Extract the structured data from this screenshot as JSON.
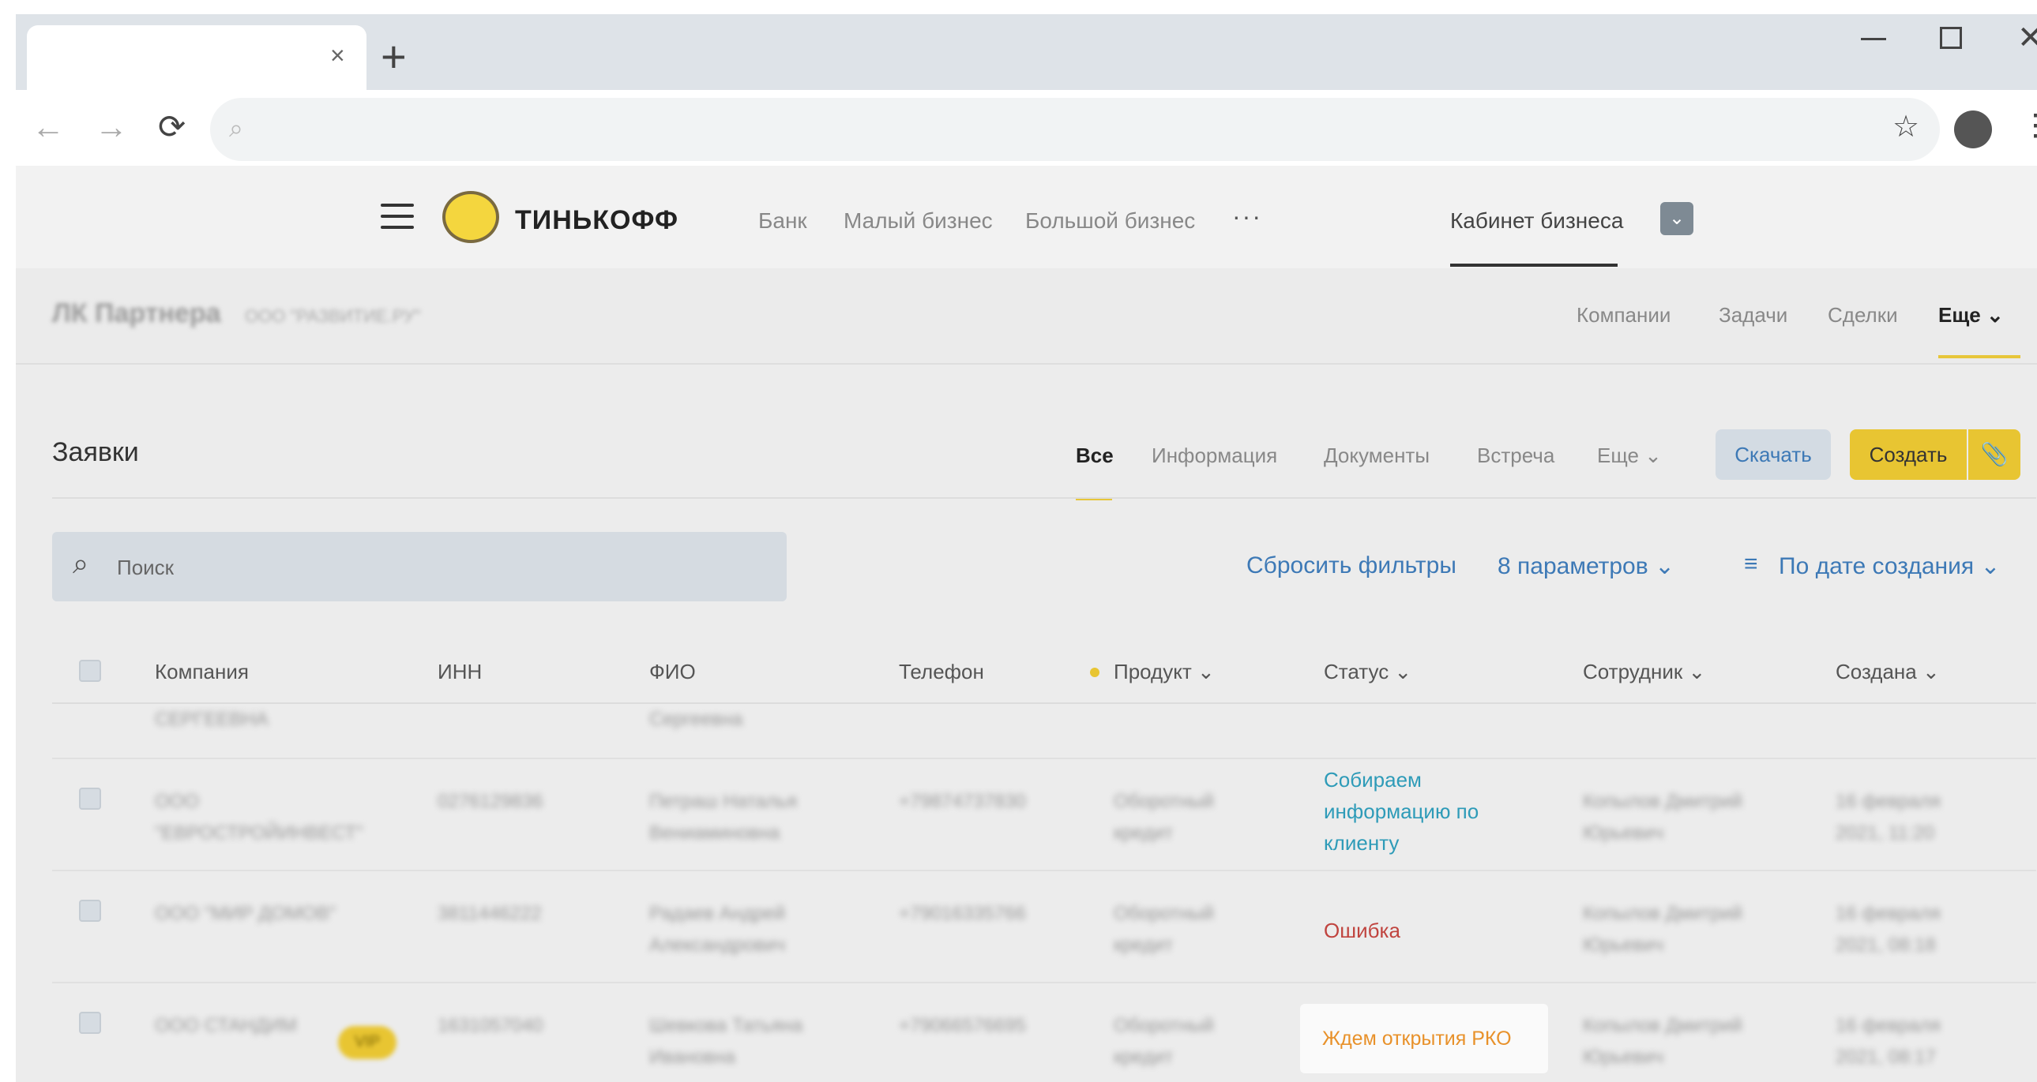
{
  "browser": {
    "tab_close": "×",
    "new_tab": "+",
    "window_close": "✕"
  },
  "header": {
    "logo_text": "ТИНЬКОФФ",
    "nav": [
      "Банк",
      "Малый бизнес",
      "Большой бизнес"
    ],
    "more_dots": "···",
    "cabinet": "Кабинет бизнеса",
    "cabinet_toggle": "⌄"
  },
  "subheader": {
    "title": "ЛК Партнера",
    "company": "ООО \"РАЗВИТИЕ.РУ\"",
    "nav": [
      "Компании",
      "Задачи",
      "Сделки"
    ],
    "more": "Еще ⌄"
  },
  "requests": {
    "title": "Заявки",
    "tabs": [
      "Все",
      "Информация",
      "Документы",
      "Встреча",
      "Еще ⌄"
    ],
    "download": "Скачать",
    "create": "Создать",
    "attach_icon": "📎"
  },
  "filters": {
    "search_placeholder": "Поиск",
    "reset": "Сбросить фильтры",
    "params": "8 параметров ⌄",
    "sort": "По дате создания ⌄"
  },
  "table": {
    "columns": [
      "Компания",
      "ИНН",
      "ФИО",
      "Телефон",
      "Продукт ⌄",
      "Статус ⌄",
      "Сотрудник ⌄",
      "Создана ⌄"
    ],
    "rows": [
      {
        "company": "СЕРГЕЕВНА",
        "inn": "",
        "fio": "Сергеевна",
        "phone": "",
        "product": "",
        "status": "",
        "employee": "",
        "created": ""
      },
      {
        "company": "ООО \"ЕВРОСТРОЙИНВЕСТ\"",
        "inn": "0276129836",
        "fio": "Петраш Наталья Вениаминовна",
        "phone": "+79874737830",
        "product": "Оборотный кредит",
        "status": "Собираем информацию по клиенту",
        "employee": "Копылов Дмитрий Юрьевич",
        "created": "16 февраля 2021, 11:20"
      },
      {
        "company": "ООО \"МИР ДОМОВ\"",
        "inn": "3811446222",
        "fio": "Радаев Андрей Александрович",
        "phone": "+79016335766",
        "product": "Оборотный кредит",
        "status": "Ошибка",
        "employee": "Копылов Дмитрий Юрьевич",
        "created": "16 февраля 2021, 08:18"
      },
      {
        "company": "ООО СТАНДИМ",
        "inn": "1631057040",
        "fio": "Шевкова Татьяна Ивановна",
        "phone": "+79066576695",
        "product": "Оборотный кредит",
        "status": "Ждем открытия РКО",
        "employee": "Копылов Дмитрий Юрьевич",
        "created": "16 февраля 2021, 08:17",
        "badge": "VIP"
      }
    ]
  }
}
